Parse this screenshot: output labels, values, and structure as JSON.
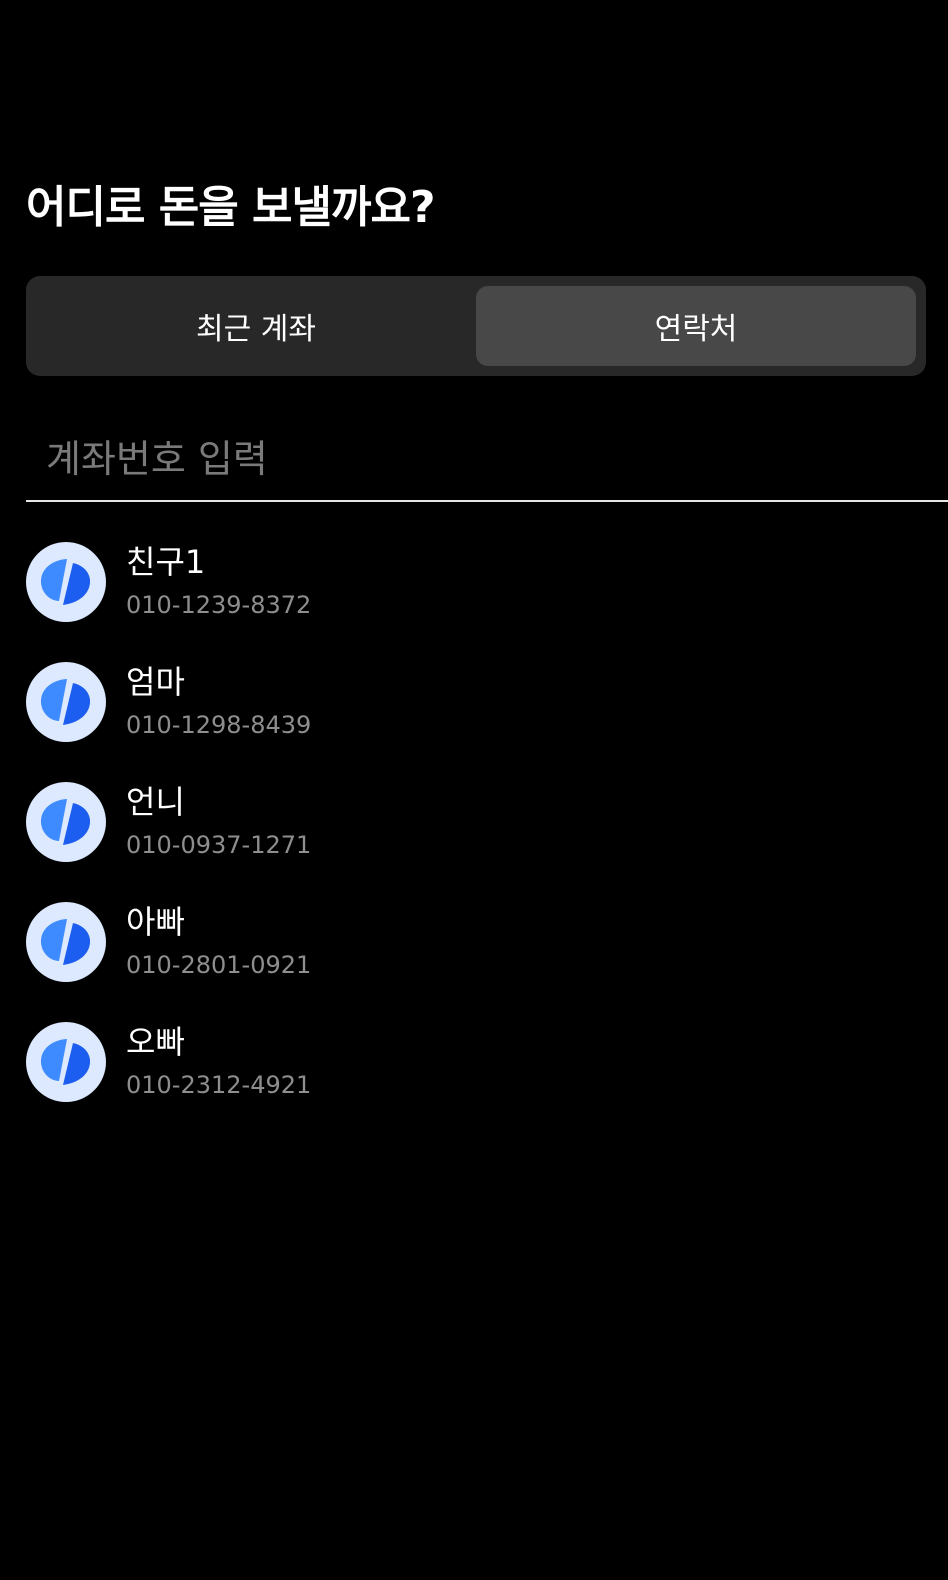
{
  "header": {
    "title": "어디로 돈을 보낼까요?"
  },
  "tabs": [
    {
      "label": "최근 계좌",
      "active": false
    },
    {
      "label": "연락처",
      "active": true
    }
  ],
  "search": {
    "placeholder": "계좌번호 입력",
    "value": ""
  },
  "contacts": [
    {
      "name": "친구1",
      "phone": "010-1239-8372",
      "icon": "toss-logo-icon"
    },
    {
      "name": "엄마",
      "phone": "010-1298-8439",
      "icon": "toss-logo-icon"
    },
    {
      "name": "언니",
      "phone": "010-0937-1271",
      "icon": "toss-logo-icon"
    },
    {
      "name": "아빠",
      "phone": "010-2801-0921",
      "icon": "toss-logo-icon"
    },
    {
      "name": "오빠",
      "phone": "010-2312-4921",
      "icon": "toss-logo-icon"
    }
  ],
  "colors": {
    "background": "#000000",
    "segment_bg": "#282828",
    "segment_active": "#484848",
    "avatar_bg": "#dde9ff",
    "accent_blue": "#1b64f5",
    "secondary_text": "#8e8e8e"
  }
}
